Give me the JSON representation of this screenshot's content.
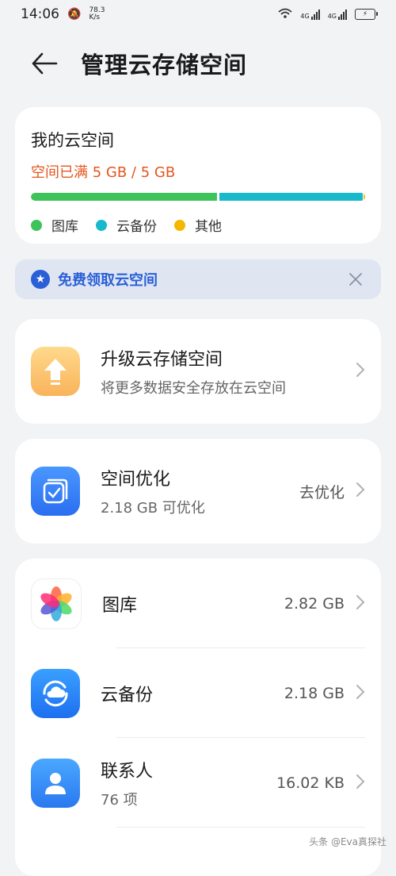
{
  "status_bar": {
    "time": "14:06",
    "net_speed_value": "78.3",
    "net_speed_unit": "K/s",
    "network_label_1": "4G",
    "network_label_2": "4G"
  },
  "header": {
    "title": "管理云存储空间"
  },
  "storage": {
    "title": "我的云空间",
    "status": "空间已满 5 GB / 5 GB",
    "usage": {
      "gallery_gb": 2.82,
      "backup_gb": 2.18,
      "other_fraction": 0.005
    },
    "legend": [
      {
        "label": "图库",
        "color": "#3dc35a"
      },
      {
        "label": "云备份",
        "color": "#18b9cc"
      },
      {
        "label": "其他",
        "color": "#f5b800"
      }
    ]
  },
  "banner": {
    "text": "免费领取云空间"
  },
  "upgrade": {
    "title": "升级云存储空间",
    "subtitle": "将更多数据安全存放在云空间"
  },
  "optimize": {
    "title": "空间优化",
    "subtitle": "2.18 GB 可优化",
    "action": "去优化"
  },
  "items": [
    {
      "title": "图库",
      "value": "2.82 GB",
      "icon": "gallery-icon"
    },
    {
      "title": "云备份",
      "value": "2.18 GB",
      "icon": "cloud-backup-icon"
    },
    {
      "title": "联系人",
      "subtitle": "76 项",
      "value": "16.02 KB",
      "icon": "contacts-icon"
    }
  ],
  "watermark": "头条 @Eva真探社",
  "colors": {
    "accent": "#2a5fd8",
    "warning": "#e2571e"
  }
}
